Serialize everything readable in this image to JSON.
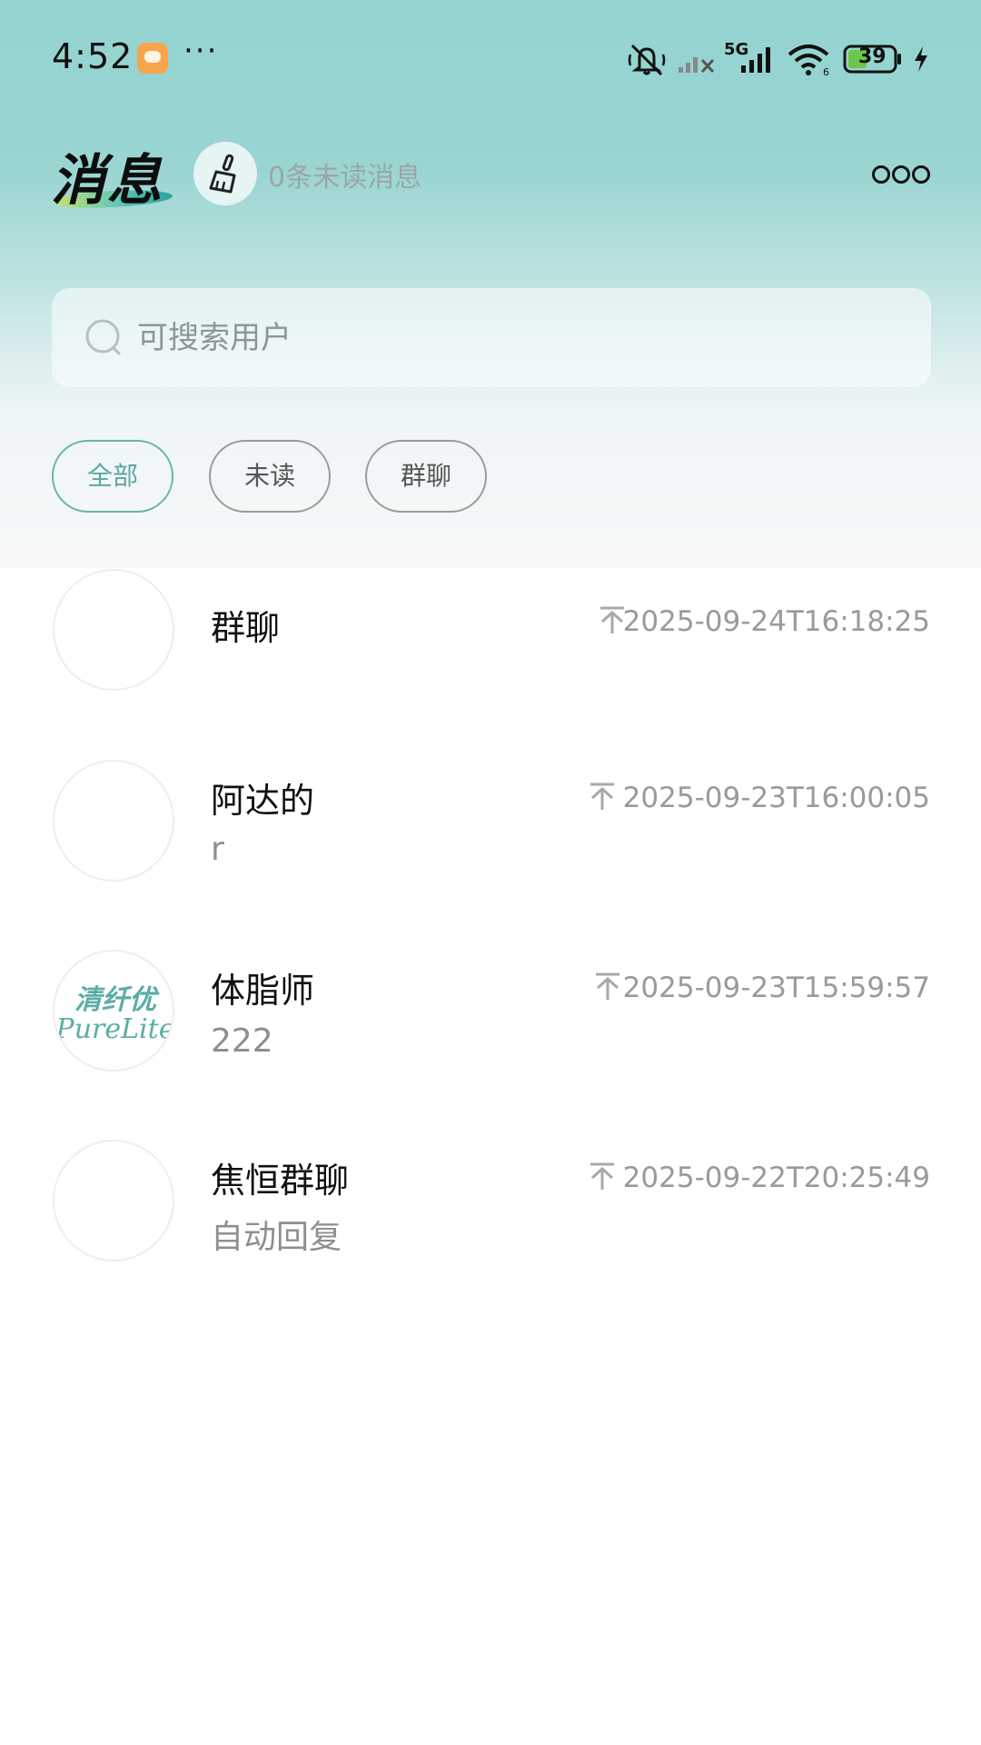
{
  "status_bar": {
    "time": "4:52",
    "more": "···",
    "network": "5G",
    "battery": "39"
  },
  "header": {
    "title": "消息",
    "unread_text": "0条未读消息"
  },
  "search": {
    "placeholder": "可搜索用户"
  },
  "filters": [
    {
      "label": "全部",
      "active": true
    },
    {
      "label": "未读",
      "active": false
    },
    {
      "label": "群聊",
      "active": false
    }
  ],
  "conversations": [
    {
      "name": "群聊",
      "preview": "",
      "time": "2025-09-24T16:18:25",
      "pinned": true
    },
    {
      "name": "阿达的",
      "preview": "r",
      "time": "2025-09-23T16:00:05",
      "pinned": true
    },
    {
      "name": "体脂师",
      "preview": "222",
      "time": "2025-09-23T15:59:57",
      "pinned": true,
      "avatar_logo_cn": "清纤优",
      "avatar_logo_en": "PureLite"
    },
    {
      "name": "焦恒群聊",
      "preview": "自动回复",
      "time": "2025-09-22T20:25:49",
      "pinned": true
    }
  ],
  "colors": {
    "accent": "#66b5ac",
    "header_top": "#93d3d0",
    "muted_text": "#9a9a9a"
  },
  "icons": {
    "clean": "broom-icon",
    "search": "search-icon",
    "pin": "pin-top-icon",
    "more": "more-dots-icon"
  }
}
